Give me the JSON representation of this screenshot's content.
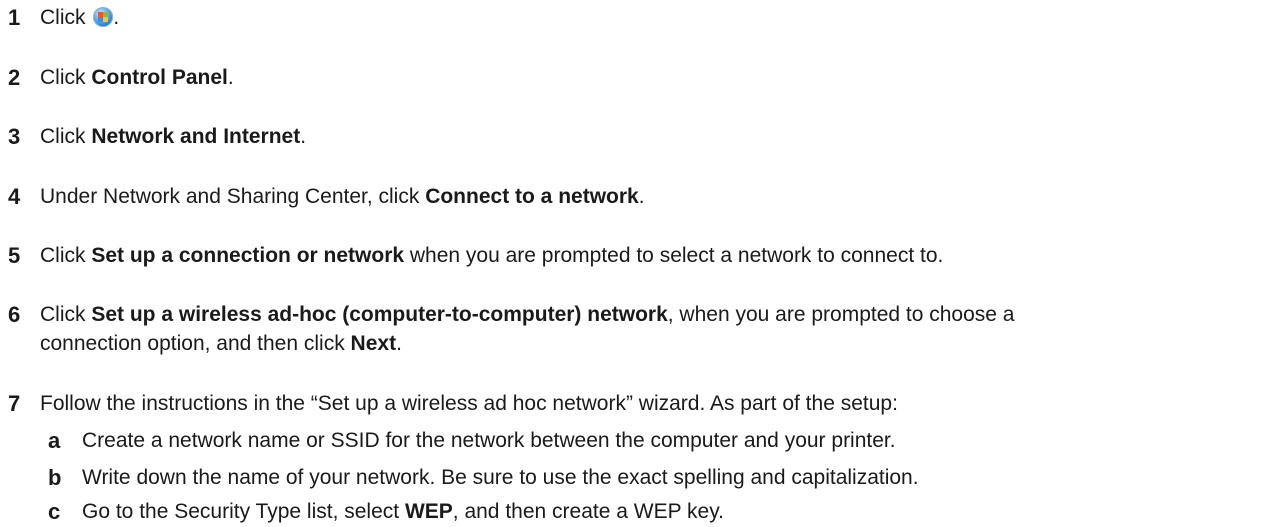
{
  "steps": [
    {
      "num": "1",
      "pre": "Click ",
      "post": "."
    },
    {
      "num": "2",
      "pre": "Click ",
      "bold": "Control Panel",
      "post": "."
    },
    {
      "num": "3",
      "pre": "Click ",
      "bold": "Network and Internet",
      "post": "."
    },
    {
      "num": "4",
      "pre": "Under Network and Sharing Center, click ",
      "bold": "Connect to a network",
      "post": "."
    },
    {
      "num": "5",
      "pre": "Click ",
      "bold": "Set up a connection or network",
      "post": " when you are prompted to select a network to connect to."
    },
    {
      "num": "6",
      "pre": "Click ",
      "bold": "Set up a wireless ad-hoc (computer-to-computer) network",
      "post": ", when you are prompted to choose a",
      "cont_pre": "connection option, and then click ",
      "cont_bold": "Next",
      "cont_post": "."
    },
    {
      "num": "7",
      "pre": "Follow the instructions in the “Set up a wireless ad hoc network” wizard. As part of the setup:"
    }
  ],
  "substeps": [
    {
      "letter": "a",
      "pre": "Create a network name or SSID for the network between the computer and your printer."
    },
    {
      "letter": "b",
      "pre": "Write down the name of your network. Be sure to use the exact spelling and capitalization."
    },
    {
      "letter": "c",
      "pre": "Go to the Security Type list, select ",
      "bold": "WEP",
      "post": ", and then create a WEP key."
    }
  ],
  "icons": {
    "start_button": "windows-start-orb-icon"
  }
}
